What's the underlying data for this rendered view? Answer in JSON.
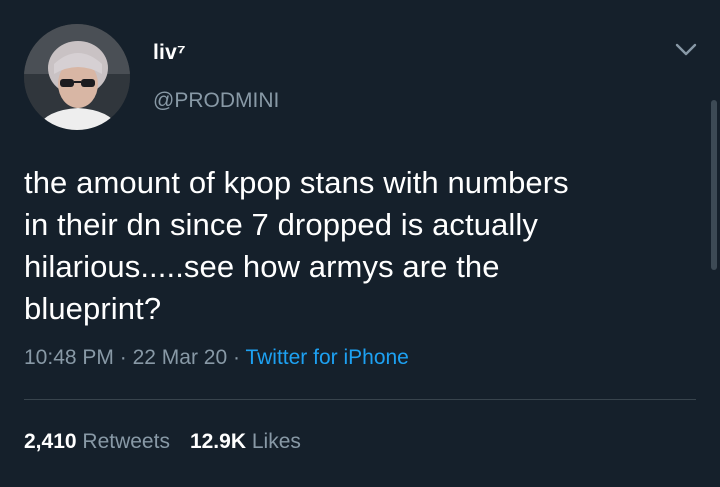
{
  "tweet": {
    "display_name": "liv⁷",
    "handle": "@PRODMINI",
    "text_lines": [
      "the amount of kpop stans with numbers",
      "in their dn since 7 dropped is actually",
      "hilarious.....see how armys are the",
      "blueprint?"
    ],
    "time": "10:48 PM",
    "date": "22 Mar 20",
    "separator": "·",
    "source": "Twitter for iPhone",
    "retweets_count": "2,410",
    "retweets_label": "Retweets",
    "likes_count": "12.9K",
    "likes_label": "Likes"
  },
  "colors": {
    "background": "#15202b",
    "primary_text": "#ffffff",
    "secondary_text": "#8899a6",
    "link": "#1da1f2",
    "divider": "#38444d"
  },
  "icons": {
    "menu": "chevron-down-icon"
  }
}
